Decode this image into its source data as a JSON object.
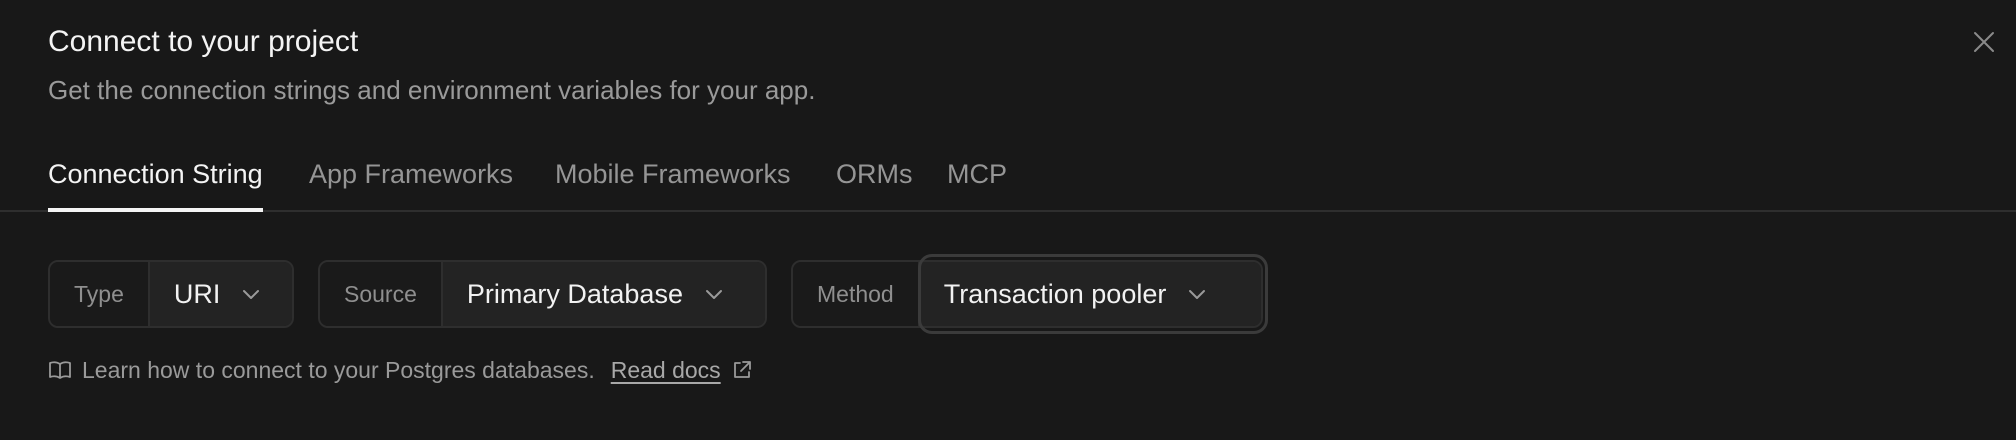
{
  "dialog": {
    "title": "Connect to your project",
    "subtitle": "Get the connection strings and environment variables for your app.",
    "close_icon": "close-icon"
  },
  "tabs": [
    {
      "label": "Connection String",
      "active": true
    },
    {
      "label": "App Frameworks",
      "active": false
    },
    {
      "label": "Mobile Frameworks",
      "active": false
    },
    {
      "label": "ORMs",
      "active": false
    },
    {
      "label": "MCP",
      "active": false
    }
  ],
  "selectors": {
    "type": {
      "label": "Type",
      "value": "URI"
    },
    "source": {
      "label": "Source",
      "value": "Primary Database"
    },
    "method": {
      "label": "Method",
      "value": "Transaction pooler"
    }
  },
  "help": {
    "text": "Learn how to connect to your Postgres databases.",
    "link": "Read docs",
    "icons": [
      "book-icon",
      "external-link-icon"
    ]
  },
  "colors": {
    "background": "#181818",
    "text_primary": "#f4f4f4",
    "text_muted": "#9a9a9a",
    "border": "#2e2e2e"
  }
}
